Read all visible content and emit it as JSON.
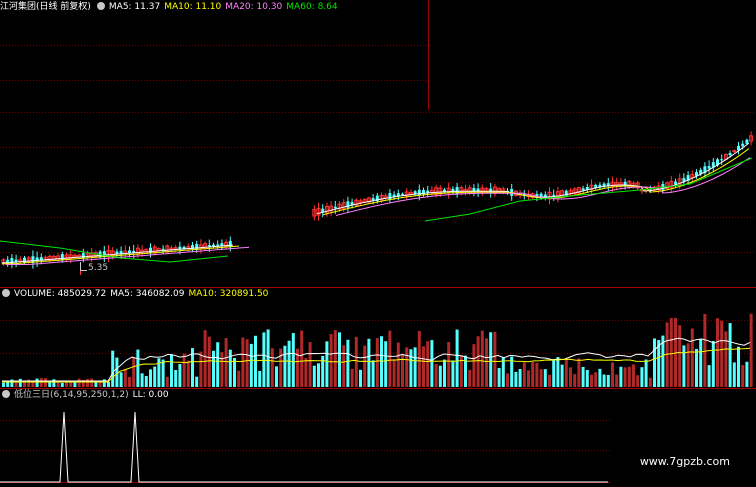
{
  "price_panel": {
    "title": "江河集团(日线 前复权)",
    "ma5_label": "MA5: 11.37",
    "ma10_label": "MA10: 11.10",
    "ma20_label": "MA20: 10.30",
    "ma60_label": "MA60: 8.64",
    "low_marker": "5.35"
  },
  "volume_panel": {
    "volume_label": "VOLUME: 485029.72",
    "ma5_label": "MA5: 346082.09",
    "ma10_label": "MA10: 320891.50"
  },
  "indicator_panel": {
    "name_label": "低位三日(6,14,95,250,1,2)",
    "ll_label": "LL: 0.00"
  },
  "watermark": "www.7gpzb.com",
  "colors": {
    "up": "#ff3232",
    "down": "#54ffff",
    "ma5": "#ffffff",
    "ma10": "#ffff00",
    "ma20": "#ff80ff",
    "ma60": "#00e600",
    "grid": "#7a0000"
  },
  "chart_data": [
    {
      "type": "candlestick",
      "name": "price",
      "title": "江河集团(日线 前复权)",
      "series": [
        {
          "name": "MA5",
          "last": 11.37
        },
        {
          "name": "MA10",
          "last": 11.1
        },
        {
          "name": "MA20",
          "last": 10.3
        },
        {
          "name": "MA60",
          "last": 8.64
        }
      ],
      "annotations": [
        "5.35"
      ]
    },
    {
      "type": "bar",
      "name": "volume",
      "series": [
        {
          "name": "VOLUME",
          "last": 485029.72
        },
        {
          "name": "MA5",
          "last": 346082.09
        },
        {
          "name": "MA10",
          "last": 320891.5
        }
      ]
    },
    {
      "type": "line",
      "name": "indicator",
      "series": [
        {
          "name": "LL",
          "last": 0.0
        }
      ]
    }
  ]
}
